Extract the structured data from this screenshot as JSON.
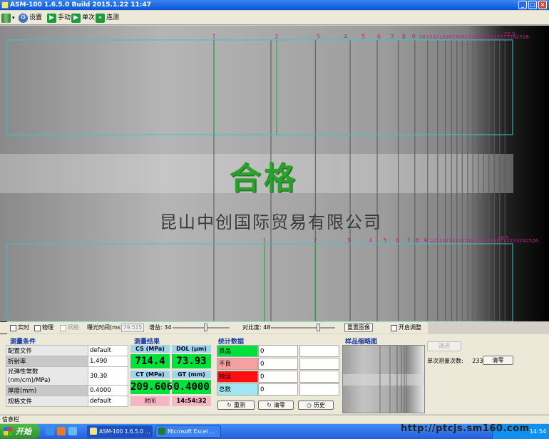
{
  "window": {
    "title": "ASM-100 1.6.5.0 Build 2015.1.22 11:47"
  },
  "toolbar": {
    "settings": "设置",
    "manual": "手动",
    "single": "单次",
    "continuous": "连测"
  },
  "viewport": {
    "upper_labels": [
      "1",
      "2",
      "3",
      "4",
      "5",
      "6",
      "7",
      "8",
      "9",
      "10",
      "11",
      "12",
      "13",
      "14",
      "15",
      "16",
      "17",
      "18",
      "19",
      "20",
      "21",
      "22",
      "23",
      "24",
      "25",
      "26"
    ],
    "upper_marker": "22.0",
    "lower_labels": [
      "1",
      "2",
      "3",
      "4",
      "5",
      "6",
      "7",
      "8",
      "9",
      "10",
      "11",
      "12",
      "13",
      "14",
      "15",
      "16",
      "17",
      "18",
      "19",
      "20",
      "21",
      "22",
      "23",
      "24",
      "25",
      "26"
    ],
    "lower_marker": "36.5",
    "pass_stamp": "合格",
    "watermark": "昆山中创国际贸易有限公司"
  },
  "controls": {
    "realtime": "实时",
    "sample": "物理",
    "grid": "网格",
    "exposure_label": "曝光时间(ms):",
    "exposure_value": "79.515",
    "gain_label": "增益: 34",
    "contrast_label": "对比度: 48",
    "reset_btn": "重置图像",
    "auto_adjust": "开启调整"
  },
  "conditions": {
    "title": "测量条件",
    "rows": [
      {
        "k": "配置文件",
        "v": "default"
      },
      {
        "k": "折射率",
        "v": "1.490"
      },
      {
        "k": "光弹性常数\n(nm/cm)/MPa)",
        "v": "30.30"
      },
      {
        "k": "厚度(mm)",
        "v": "0.4000"
      },
      {
        "k": "规格文件",
        "v": "default"
      }
    ]
  },
  "results": {
    "title": "测量结果",
    "cs_label": "CS (MPa)",
    "dol_label": "DOL (μm)",
    "cs_value": "714.4",
    "dol_value": "73.93",
    "ct_label": "CT (MPa)",
    "gt_label": "GT (mm)",
    "ct_value": "209.606",
    "gt_value": "0.4000",
    "time_label": "时间",
    "time_value": "14:54:32"
  },
  "stats": {
    "title": "统计数据",
    "rows": [
      {
        "label": "良品",
        "value": "0",
        "color": "#00e13c"
      },
      {
        "label": "不良",
        "value": "0",
        "color": "#f7a0a0"
      },
      {
        "label": "错误",
        "value": "0",
        "color": "#ff1010"
      },
      {
        "label": "总数",
        "value": "0",
        "color": "#9fe8f2"
      }
    ],
    "btn_retest": "重测",
    "btn_clear": "清零",
    "btn_history": "历史"
  },
  "thumbnail": {
    "title": "样品缩略图"
  },
  "right_panel": {
    "disabled_btn": "清进",
    "single_count_label": "单次测量次数:",
    "single_count_value": "233",
    "clear_btn": "清零"
  },
  "infobar": {
    "text": "信息栏"
  },
  "taskbar": {
    "start": "开始",
    "tasks": [
      "ASM-100 1.6.5.0 ...",
      "Microsoft Excel ..."
    ],
    "clock": "14:54",
    "site": "http://ptcjs.sm160.com"
  }
}
